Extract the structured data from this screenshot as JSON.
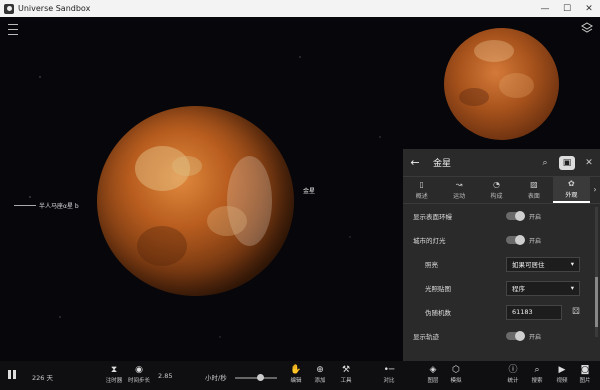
{
  "window": {
    "title": "Universe Sandbox",
    "controls": [
      "—",
      "☐",
      "✕"
    ]
  },
  "scene": {
    "venus_label": "金星",
    "alpha_label": "半人马座α星 b"
  },
  "panel": {
    "title": "金星",
    "tabs": [
      {
        "label": "概述",
        "icon": "overview-icon"
      },
      {
        "label": "运动",
        "icon": "motion-icon"
      },
      {
        "label": "构成",
        "icon": "composition-icon"
      },
      {
        "label": "表面",
        "icon": "surface-icon"
      },
      {
        "label": "外观",
        "icon": "appearance-icon",
        "active": true
      }
    ],
    "rows": [
      {
        "label": "显示表面环幔",
        "type": "toggle",
        "value": "开启"
      },
      {
        "label": "城市的灯光",
        "type": "toggle",
        "value": "开启"
      },
      {
        "label": "照亮",
        "type": "select",
        "value": "如果可居住"
      },
      {
        "label": "光照贴图",
        "type": "select",
        "value": "程序"
      },
      {
        "label": "伪随机数",
        "type": "input",
        "value": "61183"
      },
      {
        "label": "显示轨迹",
        "type": "toggle",
        "value": "开启"
      }
    ]
  },
  "toolbar": {
    "time": "226 天",
    "speed_value": "2.85",
    "speed_unit": "小时/秒",
    "left_items": [
      {
        "label": "注时器",
        "icon": "hourglass-icon"
      },
      {
        "label": "时间步长",
        "icon": "timestep-icon"
      }
    ],
    "items": [
      {
        "label": "编辑",
        "icon": "hand-icon"
      },
      {
        "label": "添加",
        "icon": "add-icon"
      },
      {
        "label": "工具",
        "icon": "wrench-icon"
      },
      {
        "label": "对比",
        "icon": "compare-icon"
      },
      {
        "label": "模拟",
        "icon": "cube-icon"
      },
      {
        "label": "图层",
        "icon": "layers-icon"
      },
      {
        "label": "统计",
        "icon": "info-icon"
      },
      {
        "label": "搜索",
        "icon": "search-icon"
      },
      {
        "label": "视频",
        "icon": "video-icon"
      },
      {
        "label": "图片",
        "icon": "camera-icon"
      }
    ]
  }
}
